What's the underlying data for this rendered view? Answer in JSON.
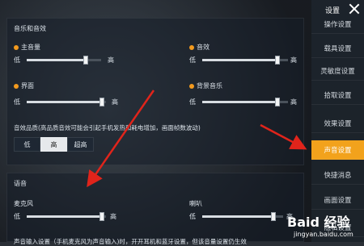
{
  "music": {
    "section_title": "音乐和音效",
    "master": {
      "label": "主音量",
      "min": "低",
      "max": "高",
      "value": 0.79
    },
    "effects": {
      "label": "音效",
      "min": "低",
      "max": "高",
      "value": 0.88
    },
    "ui": {
      "label": "界面",
      "min": "低",
      "max": "高",
      "value": 0.95
    },
    "bgm": {
      "label": "背景音乐",
      "min": "低",
      "max": "高",
      "value": 0.88
    }
  },
  "quality": {
    "label": "音效品质(高品质音效可能会引起手机发热和耗电增加，画面帧数波动)",
    "options": [
      "低",
      "高",
      "超高"
    ],
    "selected": "高"
  },
  "voice": {
    "section_title": "语音",
    "mic": {
      "label": "麦克风",
      "min": "低",
      "max": "高",
      "value": 0.95
    },
    "speaker": {
      "label": "喇叭",
      "min": "低",
      "max": "高",
      "value": 0.88
    },
    "footer": "声音输入设置（手机麦克风为声音输入)时，开开耳机和蓝牙设置，但该音量设置仍生效"
  },
  "sidebar": {
    "title": "设置",
    "items": [
      {
        "label": "操作设置"
      },
      {
        "label": "载具设置"
      },
      {
        "label": "灵敏度设置"
      },
      {
        "label": "拾取设置"
      },
      {
        "label": "效果设置"
      },
      {
        "label": "声音设置"
      },
      {
        "label": "快捷消息"
      },
      {
        "label": "画面设置"
      },
      {
        "label": "隐私设置"
      }
    ],
    "active_index": 5
  },
  "watermark": {
    "main": "Baid 经验",
    "sub": "jingyan.baidu.com"
  },
  "colors": {
    "accent": "#f2a21c",
    "arrow": "#e0241b"
  }
}
